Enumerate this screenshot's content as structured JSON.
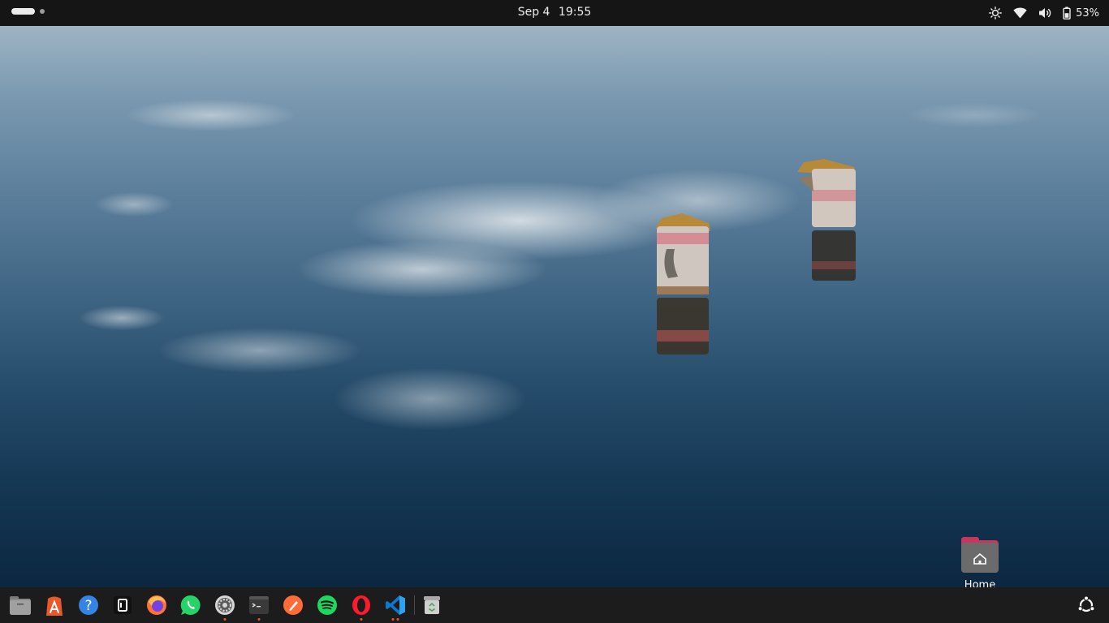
{
  "topbar": {
    "date": "Sep 4",
    "time": "19:55",
    "battery_percent": "53%",
    "tray_icons": [
      "brightness-icon",
      "wifi-icon",
      "volume-icon",
      "battery-icon"
    ],
    "workspaces": {
      "count": 2,
      "active": 1
    }
  },
  "desktop": {
    "home_label": "Home",
    "accent": "#c7375d"
  },
  "dock": {
    "apps": [
      {
        "name": "files",
        "icon": "files-icon",
        "running": false
      },
      {
        "name": "app-center",
        "icon": "app-center-icon",
        "running": false
      },
      {
        "name": "help",
        "icon": "help-icon",
        "running": false
      },
      {
        "name": "notion",
        "icon": "notion-icon",
        "running": false
      },
      {
        "name": "firefox",
        "icon": "firefox-icon",
        "running": false
      },
      {
        "name": "whatsapp",
        "icon": "whatsapp-icon",
        "running": false
      },
      {
        "name": "settings",
        "icon": "settings-icon",
        "running": true
      },
      {
        "name": "terminal",
        "icon": "terminal-icon",
        "running": true
      },
      {
        "name": "postman",
        "icon": "postman-icon",
        "running": false
      },
      {
        "name": "spotify",
        "icon": "spotify-icon",
        "running": false
      },
      {
        "name": "opera",
        "icon": "opera-icon",
        "running": true
      },
      {
        "name": "vscode",
        "icon": "vscode-icon",
        "running": true,
        "windows": 2
      },
      {
        "name": "trash",
        "icon": "trash-icon",
        "running": false
      }
    ],
    "show_apps_icon": "ubuntu-show-apps-icon"
  }
}
